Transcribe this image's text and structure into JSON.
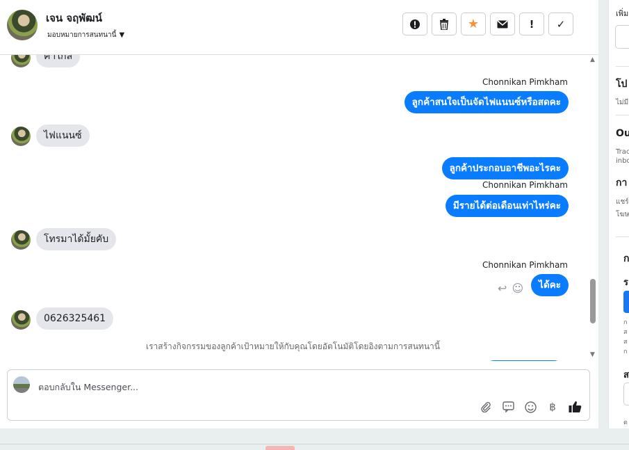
{
  "header": {
    "contact_name": "เจน จฤพัฒน์",
    "assign_label": "มอบหมายการสนทนานี้",
    "toolbar": [
      {
        "name": "alert-circle-icon",
        "glyph": "!"
      },
      {
        "name": "trash-icon",
        "glyph": "🗑"
      },
      {
        "name": "star-icon",
        "glyph": "★"
      },
      {
        "name": "mail-icon",
        "glyph": "✉"
      },
      {
        "name": "exclamation-icon",
        "glyph": "!"
      },
      {
        "name": "check-icon",
        "glyph": "✓"
      }
    ],
    "colors": {
      "star": "#f7923b"
    }
  },
  "messages": {
    "top_partial": "ค่าใกล้",
    "sender_agent": "Chonnikan Pimkham",
    "out_1": "ลูกค้าสนใจเป็นจัดไฟแนนซ์หรือสดคะ",
    "in_1": "ไฟแนนซ์",
    "out_2": "ลูกค้าประกอบอาชีพอะไรคะ",
    "out_3": "มีรายได้ต่อเดือนเท่าไหร่คะ",
    "in_2": "โทรมาได้มั้ยคับ",
    "out_4": "ได้คะ",
    "in_3": "0626325461",
    "system_note": "เราสร้างกิจกรรมของลูกค้าเป้าหมายให้กับคุณโดยอัตโนมัติโดยอิงตามการสนทนานี้",
    "colors": {
      "outgoing": "#0a7cff",
      "incoming": "#e4e6eb"
    }
  },
  "composer": {
    "placeholder": "ตอบกลับใน Messenger...",
    "tools": [
      "paperclip-icon",
      "speech-bubble-icon",
      "smiley-icon",
      "baht-icon",
      "thumbs-up-icon"
    ]
  },
  "sidebar": {
    "t1": "เพิ่ม",
    "t2": "โป",
    "t3": "ไม่มี",
    "t4": "Ou",
    "t5": "Trac",
    "t6": "inbo",
    "t7": "กา",
    "t8": "แชร์",
    "t9": "โฆษ",
    "t10": "ก",
    "t11": "ร",
    "t12": "ก",
    "t13": "ส",
    "t14": "ส",
    "t15": "ก",
    "t16": "ส",
    "t17": "ต"
  }
}
